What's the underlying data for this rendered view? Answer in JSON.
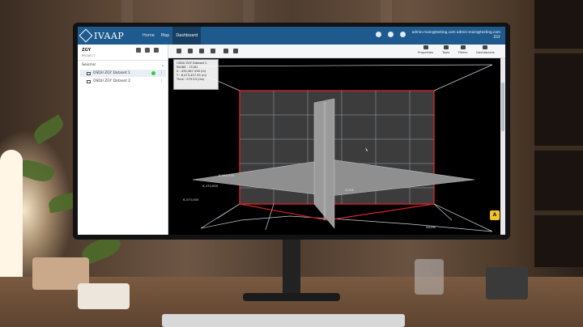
{
  "app": {
    "brand": "IVAAP",
    "nav": [
      "Home",
      "Map",
      "Dashboard"
    ],
    "active_nav": "Dashboard",
    "user_email": "admin-main@testing.com admin-main@testing.com",
    "user_sub": "ZGY"
  },
  "left_panel": {
    "project_name": "ZGY",
    "project_sub": "PROJECT",
    "section": "Seismic",
    "datasets": [
      {
        "label": "OSDU ZGY Dataset 1",
        "selected": true,
        "status_color": "#2ecc40"
      },
      {
        "label": "OSDU ZGY Dataset 2",
        "selected": false,
        "status_color": ""
      }
    ]
  },
  "toolbar": {
    "right_tools": [
      "Properties",
      "Tools",
      "Filters",
      "Dashboards"
    ]
  },
  "viewer": {
    "info_lines": [
      "OSDU ZGY Dataset 1",
      "INLINE : 15181",
      "X : 435,467.558 (m)",
      "Y : 6,473,457.33 (m)",
      "Time : 979.53 (ms)"
    ],
    "axis_labels": [
      "6,468,400",
      "6,470,800",
      "6,473,000",
      "XLINE",
      "INLINE"
    ],
    "corner_badge": "A",
    "colors": {
      "box_outline": "#d0262a",
      "grid": "#c9ced4",
      "slice": "#8f8f8f"
    }
  },
  "icons": [
    "help-icon",
    "bell-icon",
    "user-icon",
    "settings-icon",
    "filter-icon",
    "plus-icon",
    "camera-icon",
    "move-icon",
    "star-icon",
    "chevron-down-icon",
    "more-vert-icon",
    "grid-icon"
  ]
}
